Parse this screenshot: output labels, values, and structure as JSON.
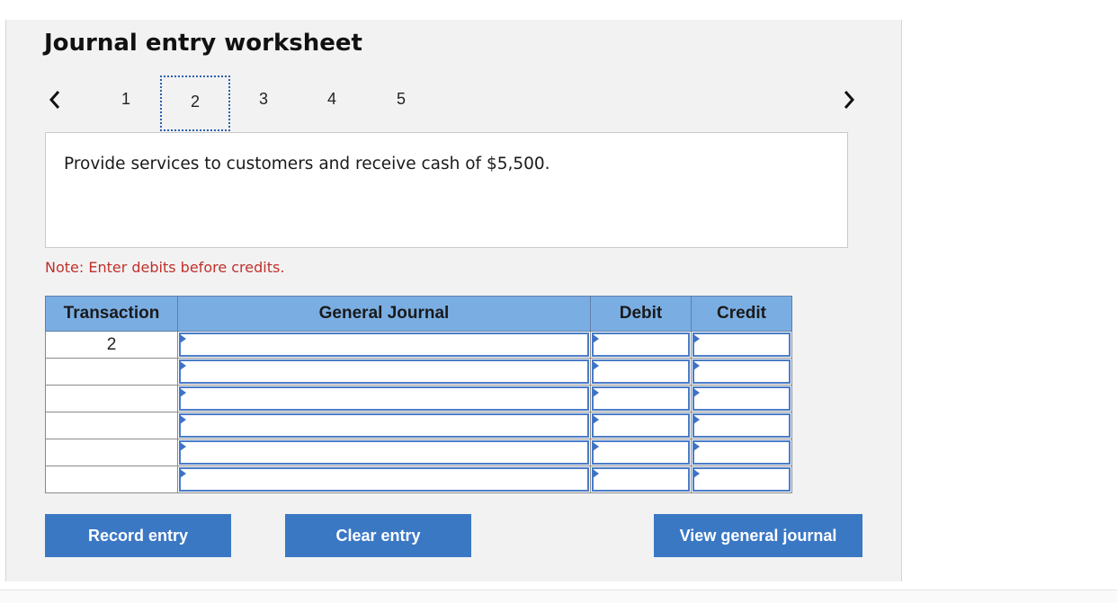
{
  "worksheet": {
    "title": "Journal entry worksheet",
    "steps": [
      "1",
      "2",
      "3",
      "4",
      "5"
    ],
    "active_step": "2",
    "question": "Provide services to customers and receive cash of $5,500.",
    "note": "Note: Enter debits before credits."
  },
  "table": {
    "headers": {
      "transaction": "Transaction",
      "general_journal": "General Journal",
      "debit": "Debit",
      "credit": "Credit"
    },
    "rows": [
      {
        "transaction": "2",
        "account": "",
        "debit": "",
        "credit": ""
      },
      {
        "transaction": "",
        "account": "",
        "debit": "",
        "credit": ""
      },
      {
        "transaction": "",
        "account": "",
        "debit": "",
        "credit": ""
      },
      {
        "transaction": "",
        "account": "",
        "debit": "",
        "credit": ""
      },
      {
        "transaction": "",
        "account": "",
        "debit": "",
        "credit": ""
      },
      {
        "transaction": "",
        "account": "",
        "debit": "",
        "credit": ""
      }
    ]
  },
  "buttons": {
    "record": "Record entry",
    "clear": "Clear entry",
    "view": "View general journal"
  },
  "icons": {
    "prev": "chevron-left-icon",
    "next": "chevron-right-icon"
  },
  "colors": {
    "header_bg": "#7aaee3",
    "button_bg": "#3b78c4",
    "note_text": "#c0312b"
  }
}
